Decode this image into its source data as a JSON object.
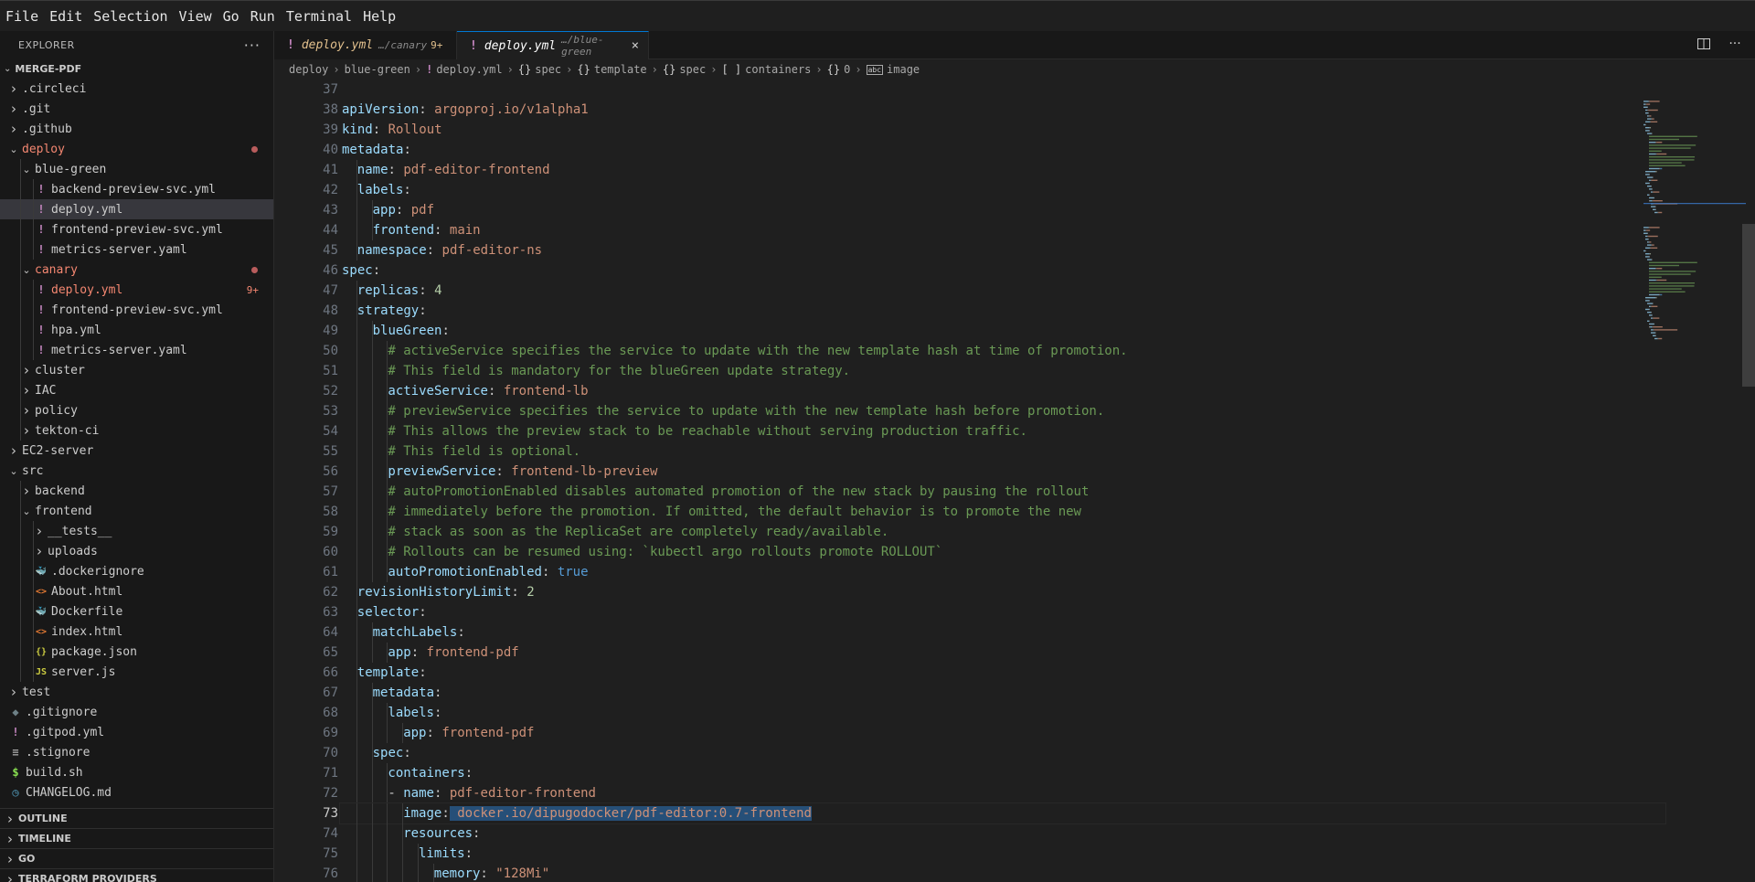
{
  "menu": [
    "File",
    "Edit",
    "Selection",
    "View",
    "Go",
    "Run",
    "Terminal",
    "Help"
  ],
  "explorer": {
    "title": "EXPLORER",
    "more": "···",
    "root": "MERGE-PDF",
    "items": [
      {
        "name": ".circleci",
        "depth": 1,
        "kind": "folder",
        "open": false
      },
      {
        "name": ".git",
        "depth": 1,
        "kind": "folder",
        "open": false
      },
      {
        "name": ".github",
        "depth": 1,
        "kind": "folder",
        "open": false
      },
      {
        "name": "deploy",
        "depth": 1,
        "kind": "folder",
        "open": true,
        "status": "error-dot"
      },
      {
        "name": "blue-green",
        "depth": 2,
        "kind": "folder",
        "open": true
      },
      {
        "name": "backend-preview-svc.yml",
        "depth": 3,
        "kind": "yaml"
      },
      {
        "name": "deploy.yml",
        "depth": 3,
        "kind": "yaml",
        "selected": true
      },
      {
        "name": "frontend-preview-svc.yml",
        "depth": 3,
        "kind": "yaml"
      },
      {
        "name": "metrics-server.yaml",
        "depth": 3,
        "kind": "yaml"
      },
      {
        "name": "canary",
        "depth": 2,
        "kind": "folder",
        "open": true,
        "status": "error-dot"
      },
      {
        "name": "deploy.yml",
        "depth": 3,
        "kind": "yaml",
        "status": "error",
        "badge": "9+"
      },
      {
        "name": "frontend-preview-svc.yml",
        "depth": 3,
        "kind": "yaml"
      },
      {
        "name": "hpa.yml",
        "depth": 3,
        "kind": "yaml"
      },
      {
        "name": "metrics-server.yaml",
        "depth": 3,
        "kind": "yaml"
      },
      {
        "name": "cluster",
        "depth": 2,
        "kind": "folder",
        "open": false
      },
      {
        "name": "IAC",
        "depth": 2,
        "kind": "folder",
        "open": false
      },
      {
        "name": "policy",
        "depth": 2,
        "kind": "folder",
        "open": false
      },
      {
        "name": "tekton-ci",
        "depth": 2,
        "kind": "folder",
        "open": false
      },
      {
        "name": "EC2-server",
        "depth": 1,
        "kind": "folder",
        "open": false
      },
      {
        "name": "src",
        "depth": 1,
        "kind": "folder",
        "open": true
      },
      {
        "name": "backend",
        "depth": 2,
        "kind": "folder",
        "open": false
      },
      {
        "name": "frontend",
        "depth": 2,
        "kind": "folder",
        "open": true
      },
      {
        "name": "__tests__",
        "depth": 3,
        "kind": "folder",
        "open": false
      },
      {
        "name": "uploads",
        "depth": 3,
        "kind": "folder",
        "open": false
      },
      {
        "name": ".dockerignore",
        "depth": 3,
        "kind": "docker"
      },
      {
        "name": "About.html",
        "depth": 3,
        "kind": "html"
      },
      {
        "name": "Dockerfile",
        "depth": 3,
        "kind": "docker"
      },
      {
        "name": "index.html",
        "depth": 3,
        "kind": "html"
      },
      {
        "name": "package.json",
        "depth": 3,
        "kind": "json"
      },
      {
        "name": "server.js",
        "depth": 3,
        "kind": "js"
      },
      {
        "name": "test",
        "depth": 1,
        "kind": "folder",
        "open": false
      },
      {
        "name": ".gitignore",
        "depth": 1,
        "kind": "git"
      },
      {
        "name": ".gitpod.yml",
        "depth": 1,
        "kind": "yaml"
      },
      {
        "name": ".stignore",
        "depth": 1,
        "kind": "text"
      },
      {
        "name": "build.sh",
        "depth": 1,
        "kind": "shell"
      },
      {
        "name": "CHANGELOG.md",
        "depth": 1,
        "kind": "clock"
      }
    ],
    "panels": [
      "OUTLINE",
      "TIMELINE",
      "GO",
      "TERRAFORM PROVIDERS"
    ]
  },
  "icons": {
    "yaml": "!",
    "docker": "🐳",
    "html": "<>",
    "json": "{}",
    "js": "JS",
    "git": "◆",
    "text": "≡",
    "shell": "$",
    "clock": "◷"
  },
  "colors": {
    "yaml": "#c586c0",
    "docker": "#3b8eea",
    "html": "#e37933",
    "json": "#cbcb41",
    "js": "#cbcb41",
    "git": "#6d8086",
    "text": "#a0a0a0",
    "shell": "#89e051",
    "clock": "#519aba",
    "accent": "#0078d4",
    "error": "#f48771",
    "modified": "#e2c08d"
  },
  "tabs": [
    {
      "name": "deploy.yml",
      "desc": "…/canary",
      "badge": "9+",
      "active": false
    },
    {
      "name": "deploy.yml",
      "desc": "…/blue-green",
      "close": "×",
      "active": true
    }
  ],
  "tab_actions": {
    "split": "▯",
    "more": "···"
  },
  "breadcrumb": [
    {
      "icon": "",
      "label": "deploy"
    },
    {
      "icon": "",
      "label": "blue-green"
    },
    {
      "icon": "!",
      "label": "deploy.yml"
    },
    {
      "icon": "{}",
      "label": "spec"
    },
    {
      "icon": "{}",
      "label": "template"
    },
    {
      "icon": "{}",
      "label": "spec"
    },
    {
      "icon": "[ ]",
      "label": "containers"
    },
    {
      "icon": "{}",
      "label": "0"
    },
    {
      "icon": "abc",
      "label": "image"
    }
  ],
  "editor": {
    "first_line": 37,
    "current_line": 73,
    "lines": [
      {
        "indent": 0,
        "parts": []
      },
      {
        "indent": 0,
        "parts": [
          [
            "k",
            "apiVersion"
          ],
          [
            "p",
            ": "
          ],
          [
            "v",
            "argoproj.io/v1alpha1"
          ]
        ]
      },
      {
        "indent": 0,
        "parts": [
          [
            "k",
            "kind"
          ],
          [
            "p",
            ": "
          ],
          [
            "v",
            "Rollout"
          ]
        ]
      },
      {
        "indent": 0,
        "parts": [
          [
            "k",
            "metadata"
          ],
          [
            "p",
            ":"
          ]
        ]
      },
      {
        "indent": 1,
        "parts": [
          [
            "k",
            "name"
          ],
          [
            "p",
            ": "
          ],
          [
            "v",
            "pdf-editor-frontend"
          ]
        ]
      },
      {
        "indent": 1,
        "parts": [
          [
            "k",
            "labels"
          ],
          [
            "p",
            ":"
          ]
        ]
      },
      {
        "indent": 2,
        "parts": [
          [
            "k",
            "app"
          ],
          [
            "p",
            ": "
          ],
          [
            "v",
            "pdf"
          ]
        ]
      },
      {
        "indent": 2,
        "parts": [
          [
            "k",
            "frontend"
          ],
          [
            "p",
            ": "
          ],
          [
            "v",
            "main"
          ]
        ]
      },
      {
        "indent": 1,
        "parts": [
          [
            "k",
            "namespace"
          ],
          [
            "p",
            ": "
          ],
          [
            "v",
            "pdf-editor-ns"
          ]
        ]
      },
      {
        "indent": 0,
        "parts": [
          [
            "k",
            "spec"
          ],
          [
            "p",
            ":"
          ]
        ]
      },
      {
        "indent": 1,
        "parts": [
          [
            "k",
            "replicas"
          ],
          [
            "p",
            ": "
          ],
          [
            "n",
            "4"
          ]
        ]
      },
      {
        "indent": 1,
        "parts": [
          [
            "k",
            "strategy"
          ],
          [
            "p",
            ":"
          ]
        ]
      },
      {
        "indent": 2,
        "parts": [
          [
            "k",
            "blueGreen"
          ],
          [
            "p",
            ":"
          ]
        ]
      },
      {
        "indent": 3,
        "parts": [
          [
            "c",
            "# activeService specifies the service to update with the new template hash at time of promotion."
          ]
        ]
      },
      {
        "indent": 3,
        "parts": [
          [
            "c",
            "# This field is mandatory for the blueGreen update strategy."
          ]
        ]
      },
      {
        "indent": 3,
        "parts": [
          [
            "k",
            "activeService"
          ],
          [
            "p",
            ": "
          ],
          [
            "v",
            "frontend-lb"
          ]
        ]
      },
      {
        "indent": 3,
        "parts": [
          [
            "c",
            "# previewService specifies the service to update with the new template hash before promotion."
          ]
        ]
      },
      {
        "indent": 3,
        "parts": [
          [
            "c",
            "# This allows the preview stack to be reachable without serving production traffic."
          ]
        ]
      },
      {
        "indent": 3,
        "parts": [
          [
            "c",
            "# This field is optional."
          ]
        ]
      },
      {
        "indent": 3,
        "parts": [
          [
            "k",
            "previewService"
          ],
          [
            "p",
            ": "
          ],
          [
            "v",
            "frontend-lb-preview"
          ]
        ]
      },
      {
        "indent": 3,
        "parts": [
          [
            "c",
            "# autoPromotionEnabled disables automated promotion of the new stack by pausing the rollout"
          ]
        ]
      },
      {
        "indent": 3,
        "parts": [
          [
            "c",
            "# immediately before the promotion. If omitted, the default behavior is to promote the new"
          ]
        ]
      },
      {
        "indent": 3,
        "parts": [
          [
            "c",
            "# stack as soon as the ReplicaSet are completely ready/available."
          ]
        ]
      },
      {
        "indent": 3,
        "parts": [
          [
            "c",
            "# Rollouts can be resumed using: `kubectl argo rollouts promote ROLLOUT`"
          ]
        ]
      },
      {
        "indent": 3,
        "parts": [
          [
            "k",
            "autoPromotionEnabled"
          ],
          [
            "p",
            ": "
          ],
          [
            "b",
            "true"
          ]
        ]
      },
      {
        "indent": 1,
        "parts": [
          [
            "k",
            "revisionHistoryLimit"
          ],
          [
            "p",
            ": "
          ],
          [
            "n",
            "2"
          ]
        ]
      },
      {
        "indent": 1,
        "parts": [
          [
            "k",
            "selector"
          ],
          [
            "p",
            ":"
          ]
        ]
      },
      {
        "indent": 2,
        "parts": [
          [
            "k",
            "matchLabels"
          ],
          [
            "p",
            ":"
          ]
        ]
      },
      {
        "indent": 3,
        "parts": [
          [
            "k",
            "app"
          ],
          [
            "p",
            ": "
          ],
          [
            "v",
            "frontend-pdf"
          ]
        ]
      },
      {
        "indent": 1,
        "parts": [
          [
            "k",
            "template"
          ],
          [
            "p",
            ":"
          ]
        ]
      },
      {
        "indent": 2,
        "parts": [
          [
            "k",
            "metadata"
          ],
          [
            "p",
            ":"
          ]
        ]
      },
      {
        "indent": 3,
        "parts": [
          [
            "k",
            "labels"
          ],
          [
            "p",
            ":"
          ]
        ]
      },
      {
        "indent": 4,
        "parts": [
          [
            "k",
            "app"
          ],
          [
            "p",
            ": "
          ],
          [
            "v",
            "frontend-pdf"
          ]
        ]
      },
      {
        "indent": 2,
        "parts": [
          [
            "k",
            "spec"
          ],
          [
            "p",
            ":"
          ]
        ]
      },
      {
        "indent": 3,
        "parts": [
          [
            "k",
            "containers"
          ],
          [
            "p",
            ":"
          ]
        ]
      },
      {
        "indent": 3,
        "parts": [
          [
            "p",
            "- "
          ],
          [
            "k",
            "name"
          ],
          [
            "p",
            ": "
          ],
          [
            "v",
            "pdf-editor-frontend"
          ]
        ]
      },
      {
        "indent": 4,
        "parts": [
          [
            "k",
            "image"
          ],
          [
            "p",
            ":"
          ],
          [
            "sel",
            " docker.io/dipugodocker/pdf-editor:0.7-frontend"
          ]
        ]
      },
      {
        "indent": 4,
        "parts": [
          [
            "k",
            "resources"
          ],
          [
            "p",
            ":"
          ]
        ]
      },
      {
        "indent": 5,
        "parts": [
          [
            "k",
            "limits"
          ],
          [
            "p",
            ":"
          ]
        ]
      },
      {
        "indent": 6,
        "parts": [
          [
            "k",
            "memory"
          ],
          [
            "p",
            ": "
          ],
          [
            "v",
            "\"128Mi\""
          ]
        ]
      }
    ]
  }
}
